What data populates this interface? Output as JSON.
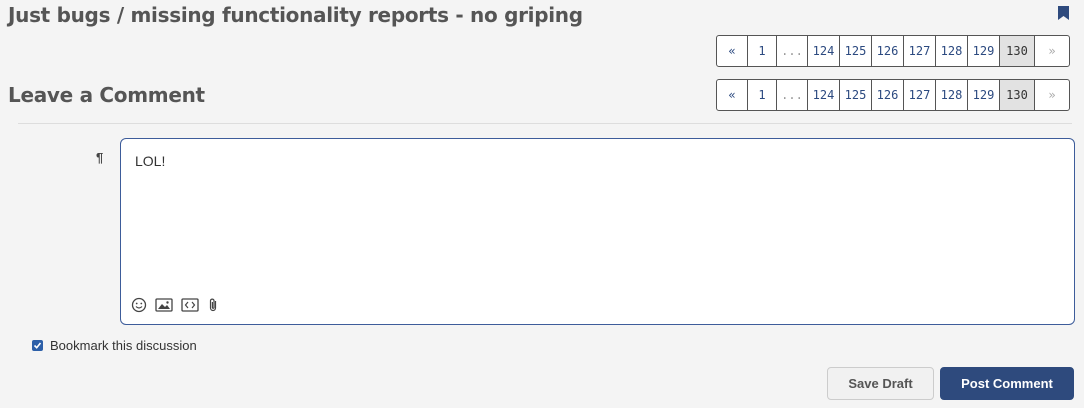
{
  "discussion": {
    "title": "Just bugs / missing functionality reports - no griping"
  },
  "pager": {
    "prev": "«",
    "first": "1",
    "gap": "...",
    "pages": [
      "124",
      "125",
      "126",
      "127",
      "128",
      "129"
    ],
    "current": "130",
    "next": "»"
  },
  "comment": {
    "heading": "Leave a Comment",
    "body": "LOL!",
    "bookmark_label": "Bookmark this discussion",
    "bookmark_checked": true
  },
  "buttons": {
    "save_draft": "Save Draft",
    "post_comment": "Post Comment"
  },
  "icons": {
    "bookmark": "bookmark-icon",
    "format": "paragraph-icon",
    "tools": [
      "emoji-icon",
      "image-icon",
      "code-icon",
      "attachment-icon"
    ]
  },
  "colors": {
    "accent": "#2e4a7d",
    "link": "#2c4a80",
    "editor_border": "#3d5c9a"
  }
}
